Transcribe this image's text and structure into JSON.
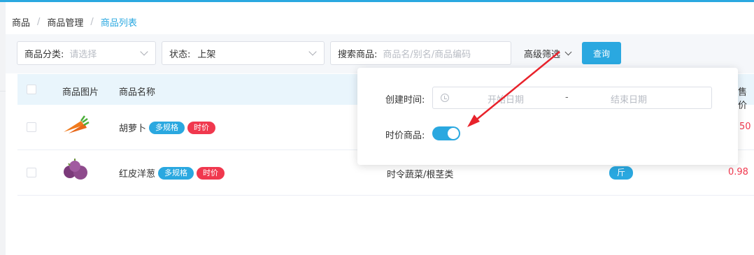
{
  "colors": {
    "accent": "#2aa8e0",
    "danger": "#f0384e",
    "header_bg": "#e9f5fc",
    "arrow": "#e8222b"
  },
  "breadcrumb": [
    "商品",
    "商品管理",
    "商品列表"
  ],
  "filters": {
    "category_label": "商品分类:",
    "category_placeholder": "请选择",
    "status_label": "状态:",
    "status_value": "上架",
    "search_label": "搜索商品:",
    "search_placeholder": "商品名/别名/商品编码",
    "advanced_label": "高级筛选",
    "query_button": "查询"
  },
  "table": {
    "columns": [
      "商品图片",
      "商品名称",
      "售价"
    ],
    "rows": [
      {
        "name": "胡萝卜",
        "image_icon": "carrot-icon",
        "tags": [
          "多规格",
          "时价"
        ],
        "price": "50"
      },
      {
        "name": "红皮洋葱",
        "image_icon": "onion-icon",
        "tags": [
          "多规格",
          "时价"
        ],
        "category": "时令蔬菜/根茎类",
        "unit": "斤",
        "price": "0.98"
      }
    ]
  },
  "advanced_popover": {
    "created_time_label": "创建时间:",
    "start_placeholder": "开始日期",
    "separator": "-",
    "end_placeholder": "结束日期",
    "time_price_label": "时价商品:",
    "time_price_enabled": true
  }
}
